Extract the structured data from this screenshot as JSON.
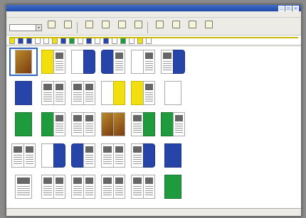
{
  "window": {
    "title": "",
    "controls": [
      "_",
      "□",
      "×"
    ]
  },
  "menu": [
    "",
    "",
    "",
    "",
    ""
  ],
  "toolbar": {
    "combo_value": "",
    "buttons": [
      {
        "icon": "undo-icon",
        "label": ""
      },
      {
        "icon": "redo-icon",
        "label": ""
      },
      {
        "icon": "view-icon",
        "label": ""
      },
      {
        "icon": "zoom-icon",
        "label": ""
      },
      {
        "icon": "page-icon",
        "label": ""
      },
      {
        "icon": "color-icon",
        "label": ""
      },
      {
        "icon": "cut-icon",
        "label": ""
      },
      {
        "icon": "copy-icon",
        "label": ""
      },
      {
        "icon": "paste-icon",
        "label": ""
      },
      {
        "icon": "print-icon",
        "label": ""
      }
    ]
  },
  "strip_markers": [
    "yellow",
    "blue",
    "blue",
    "white",
    "white",
    "yellow",
    "blue",
    "green",
    "white",
    "blue",
    "white",
    "blue",
    "white",
    "green",
    "white",
    "yellow",
    "white"
  ],
  "rows": [
    [
      [
        "photo-single"
      ],
      [
        "yellow-left",
        "doc-right"
      ],
      [
        "blank-left",
        "blue-right"
      ],
      [
        "blue-left",
        "doc-right"
      ],
      [
        "blank-left",
        "doc-right"
      ],
      [
        "doc-left",
        "blue-right"
      ]
    ],
    [
      [
        "blue-single"
      ],
      [
        "doc-left",
        "doc-right"
      ],
      [
        "doc-left",
        "doc-right"
      ],
      [
        "blank-left",
        "yellow-right"
      ],
      [
        "yellow-left",
        "doc-right"
      ],
      [
        "blank-single"
      ]
    ],
    [
      [
        "green-single"
      ],
      [
        "green-left",
        "doc-right"
      ],
      [
        "doc-left",
        "doc-right"
      ],
      [
        "photo-left",
        "photo-right"
      ],
      [
        "doc-left",
        "green-right"
      ],
      [
        "green-left",
        "doc-right"
      ]
    ],
    [
      [
        "doc-left",
        "doc-right"
      ],
      [
        "blank-left",
        "blue-right"
      ],
      [
        "blue-left",
        "doc-right"
      ],
      [
        "doc-left",
        "doc-right"
      ],
      [
        "doc-left",
        "blue-right"
      ],
      [
        "blue-single"
      ]
    ],
    [
      [
        "doc-single"
      ],
      [
        "doc-left",
        "doc-right"
      ],
      [
        "doc-left",
        "doc-right"
      ],
      [
        "doc-left",
        "doc-right"
      ],
      [
        "doc-left",
        "doc-right"
      ],
      [
        "green-single"
      ]
    ]
  ],
  "status": {
    "text": ""
  }
}
